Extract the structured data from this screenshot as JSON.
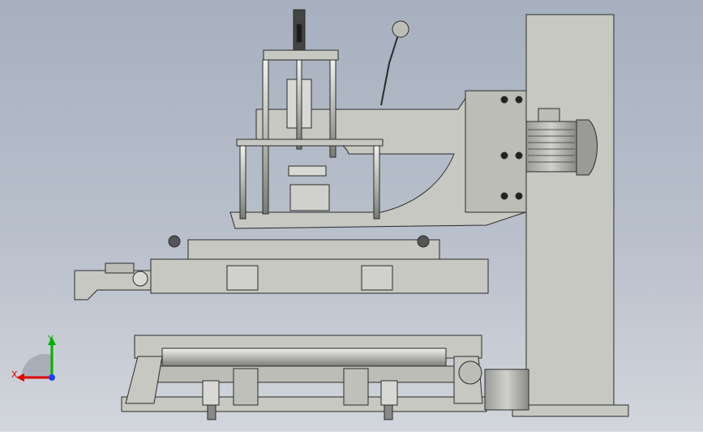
{
  "viewport": {
    "background_top": "#a7b0bf",
    "background_bottom": "#d2d6dc",
    "model_fill": "#c8c8c2",
    "model_stroke": "#2a2a2a"
  },
  "triad": {
    "x_label": "X",
    "y_label": "Y",
    "x_color": "#e00000",
    "y_color": "#00b000"
  }
}
